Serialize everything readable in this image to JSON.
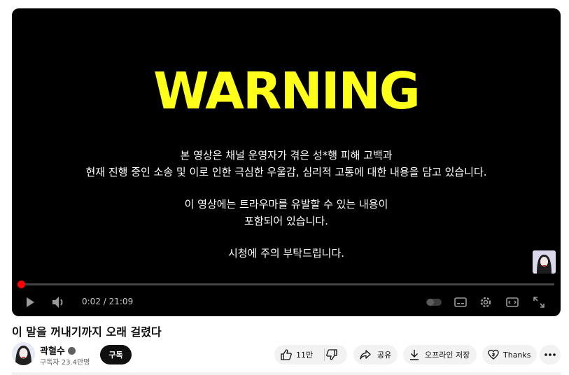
{
  "video": {
    "warning_title": "WARNING",
    "notice_lines": [
      "본 영상은 채널 운영자가 겪은 성*행 피해 고백과",
      "현재 진행 중인 소송 및 이로 인한 극심한 우울감, 심리적 고통에 대한 내용을 담고 있습니다.",
      "이 영상에는 트라우마를 유발할 수 있는 내용이",
      "포함되어 있습니다.",
      "시청에 주의 부탁드립니다."
    ],
    "warning_color": "#ffff1c"
  },
  "controls": {
    "current_time": "0:02",
    "duration": "21:09",
    "time_display": "0:02 / 21:09",
    "progress_fraction": 0.0016,
    "accent": "#ff0000"
  },
  "title": "이 말을 꺼내기까지 오래 걸렸다",
  "channel": {
    "name": "곽혈수",
    "subscribers": "구독자 23.4만명",
    "subscribe_label": "구독"
  },
  "actions": {
    "like_count": "11만",
    "share_label": "공유",
    "download_label": "오프라인 저장",
    "thanks_label": "Thanks"
  },
  "icons": [
    "play-icon",
    "volume-icon",
    "autoplay-toggle-icon",
    "subtitles-icon",
    "settings-icon",
    "miniplayer-icon",
    "fullscreen-icon",
    "like-icon",
    "dislike-icon",
    "share-icon",
    "download-icon",
    "thanks-icon",
    "more-icon",
    "verified-icon"
  ]
}
